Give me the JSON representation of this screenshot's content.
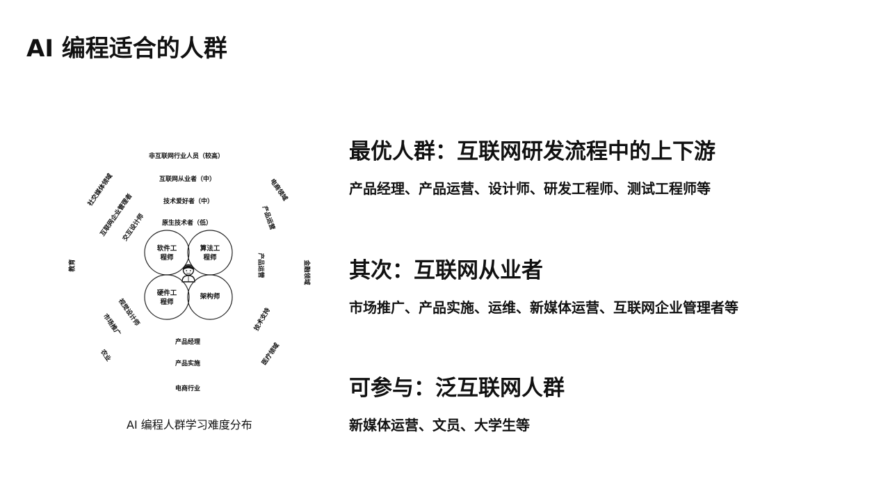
{
  "page": {
    "title": "AI 编程适合的人群"
  },
  "diagram": {
    "caption": "AI 编程人群学习难度分布",
    "petals": {
      "software": "软件工\n程师",
      "algorithm": "算法工\n程师",
      "hardware": "硬件工\n程师",
      "architect": "架构师"
    },
    "labels": {
      "non_internet": "非互联网行业人员（较高）",
      "internet_practitioner": "互联网从业者（中）",
      "tech_enthusiast": "技术爱好者（中）",
      "native_tech": "原生技术者（低）",
      "social_media": "社交媒体领域",
      "internet_manager": "互联网企业管理者",
      "interaction_designer": "交互设计师",
      "education": "教育",
      "visual_designer": "视觉设计师",
      "market_promotion": "市场推广",
      "agriculture": "农业",
      "product_manager": "产品经理",
      "product_impl": "产品实施",
      "ecommerce_industry": "电商行业",
      "ecommerce_field": "电商领域",
      "product_ops": "产品运营",
      "product_ops2": "产品运营",
      "finance_field": "金融领域",
      "tech_support": "技术支持",
      "medical_field": "医疗领域"
    }
  },
  "sections": [
    {
      "heading": "最优人群：互联网研发流程中的上下游",
      "detail": "产品经理、产品运营、设计师、研发工程师、测试工程师等"
    },
    {
      "heading": "其次：互联网从业者",
      "detail": "市场推广、产品实施、运维、新媒体运营、互联网企业管理者等"
    },
    {
      "heading": "可参与：泛互联网人群",
      "detail": "新媒体运营、文员、大学生等"
    }
  ]
}
